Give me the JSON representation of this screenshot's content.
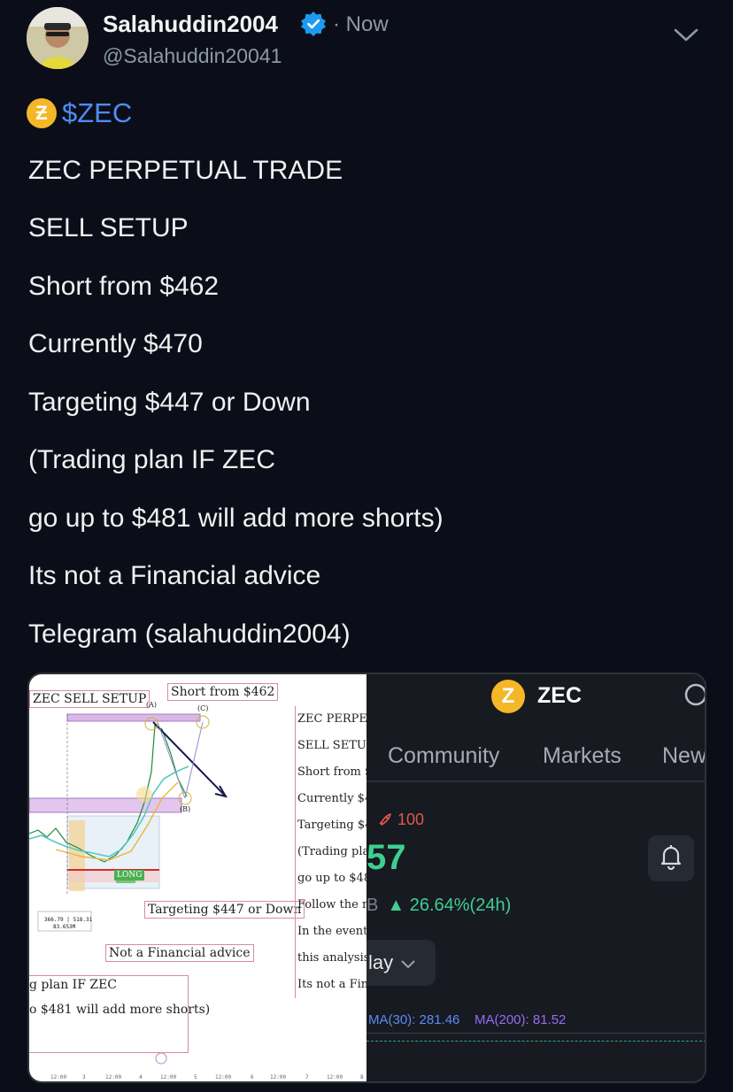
{
  "post": {
    "display_name": "Salahuddin2004",
    "handle": "@Salahuddin20041",
    "timestamp": "· Now",
    "cashtag": "$ZEC",
    "lines": [
      "ZEC PERPETUAL TRADE",
      "SELL SETUP",
      "Short from $462",
      "Currently $470",
      "Targeting $447 or Down",
      "(Trading plan IF ZEC",
      "go up to $481 will add more shorts)",
      "Its not a Financial advice",
      "Telegram (salahuddin2004)"
    ]
  },
  "chart_image": {
    "title_label": "ZEC SELL SETUP",
    "short_label": "Short from $462",
    "target_label": "Targeting $447 or Down",
    "advice_label": "Not a Financial advice",
    "long_label": "LONG",
    "plan_line_1": "g plan IF ZEC",
    "plan_line_2": "o $481 will add more shorts)",
    "point_a": "(A)",
    "point_b": "(B)",
    "point_c": "(C)",
    "price_box_1": "366.79 | 518.31",
    "price_box_2": "83.653M",
    "side_text": [
      "ZEC PERPETU",
      "SELL SETUP",
      "Short from $",
      "Currently $4",
      "Targeting $4",
      "(Trading plan",
      "go up to $48",
      "Follow the ne",
      "In the event",
      "this analysis",
      "Its not a Fina"
    ],
    "axis_labels": [
      "12:00",
      "3",
      "12:00",
      "4",
      "12:00",
      "5",
      "12:00",
      "6",
      "12:00",
      "7",
      "12:00",
      "8"
    ]
  },
  "app_screen": {
    "coin_symbol": "ZEC",
    "coin_glyph": "Z",
    "tabs": [
      "Community",
      "Markets",
      "New"
    ],
    "rank": "100",
    "price_partial": "57",
    "btc_glyph": "B",
    "change": "26.64%(24h)",
    "range": "lay",
    "ma30": "MA(30): 281.46",
    "ma200": "MA(200): 81.52",
    "colors": {
      "up": "#3ecf8e",
      "ma30": "#5b8cf0",
      "ma200": "#9a6cf0",
      "rank": "#e0574f"
    }
  },
  "icons": {
    "verified": "verified-badge-icon",
    "more": "chevron-down-icon",
    "coin": "zcash-coin-icon",
    "search": "search-icon",
    "bell": "bell-icon",
    "rocket": "rocket-icon"
  },
  "colors": {
    "background": "#0b0e19",
    "cashtag": "#4f8cf6",
    "coin": "#f4b728",
    "verified": "#1d9bf0"
  }
}
